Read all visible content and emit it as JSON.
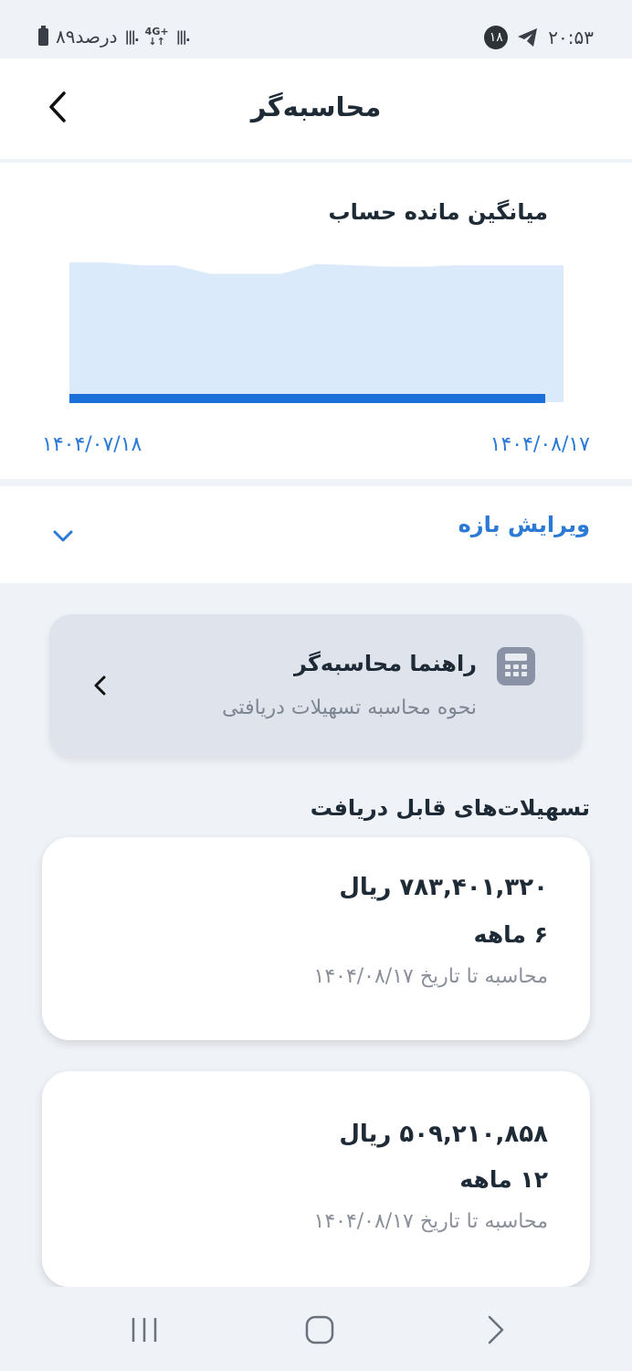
{
  "status_bar": {
    "time": "۲۰:۵۳",
    "notification_count": "۱۸",
    "battery_text": "۸۹درصد",
    "network_type": "4G+"
  },
  "app_bar": {
    "title": "محاسبه‌گر"
  },
  "balance_chart": {
    "title": "میانگین مانده حساب",
    "start_date": "۱۴۰۴/۰۸/۱۷",
    "end_date": "۱۴۰۴/۰۷/۱۸"
  },
  "chart_data": {
    "type": "area",
    "title": "میانگین مانده حساب",
    "xlabel": "",
    "ylabel": "",
    "x_range": [
      "۱۴۰۴/۰۷/۱۸",
      "۱۴۰۴/۰۸/۱۷"
    ],
    "series": [
      {
        "values": [
          0.98,
          0.98,
          0.96,
          0.96,
          0.9,
          0.9,
          0.9,
          0.97,
          0.96,
          0.95,
          0.95,
          0.96,
          0.96,
          0.96,
          0.96
        ]
      }
    ],
    "accent_color": "#1a6fd8",
    "fill_color": "#dbeafa",
    "grid": false
  },
  "range_editor": {
    "label": "ویرایش بازه"
  },
  "guide_card": {
    "title": "راهنما محاسبه‌گر",
    "subtitle": "نحوه محاسبه تسهیلات دریافتی",
    "icon": "calculator-icon"
  },
  "loans_section": {
    "title": "تسهیلات‌های قابل دریافت",
    "items": [
      {
        "amount": "۷۸۳,۴۰۱,۳۲۰ ریال",
        "term": "۶ ماهه",
        "date_note": "محاسبه تا تاریخ ۱۴۰۴/۰۸/۱۷"
      },
      {
        "amount": "۵۰۹,۲۱۰,۸۵۸ ریال",
        "term": "۱۲ ماهه",
        "date_note": "محاسبه تا تاریخ ۱۴۰۴/۰۸/۱۷"
      }
    ]
  },
  "colors": {
    "accent": "#2a7ad6",
    "background": "#eff2f7",
    "card": "#ffffff"
  }
}
